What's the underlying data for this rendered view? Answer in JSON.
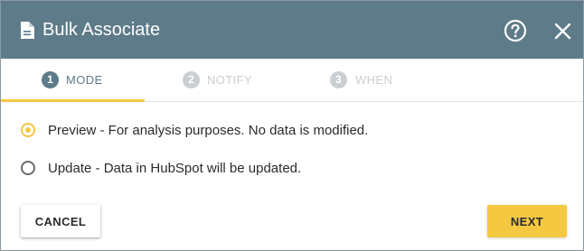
{
  "dialog": {
    "title": "Bulk Associate",
    "icons": {
      "title_icon": "document-icon",
      "help_icon": "help-circle-icon",
      "close_icon": "close-icon"
    }
  },
  "steps": [
    {
      "number": "1",
      "label": "MODE",
      "active": true
    },
    {
      "number": "2",
      "label": "NOTIFY",
      "active": false
    },
    {
      "number": "3",
      "label": "WHEN",
      "active": false
    }
  ],
  "options": [
    {
      "label": "Preview - For analysis purposes. No data is modified.",
      "selected": true
    },
    {
      "label": "Update - Data in HubSpot will be updated.",
      "selected": false
    }
  ],
  "buttons": {
    "cancel": "CANCEL",
    "next": "NEXT"
  },
  "colors": {
    "header_bg": "#5e7b89",
    "accent": "#f5c842",
    "inactive_step": "#c9cfd3",
    "text": "#2b2b2b"
  }
}
